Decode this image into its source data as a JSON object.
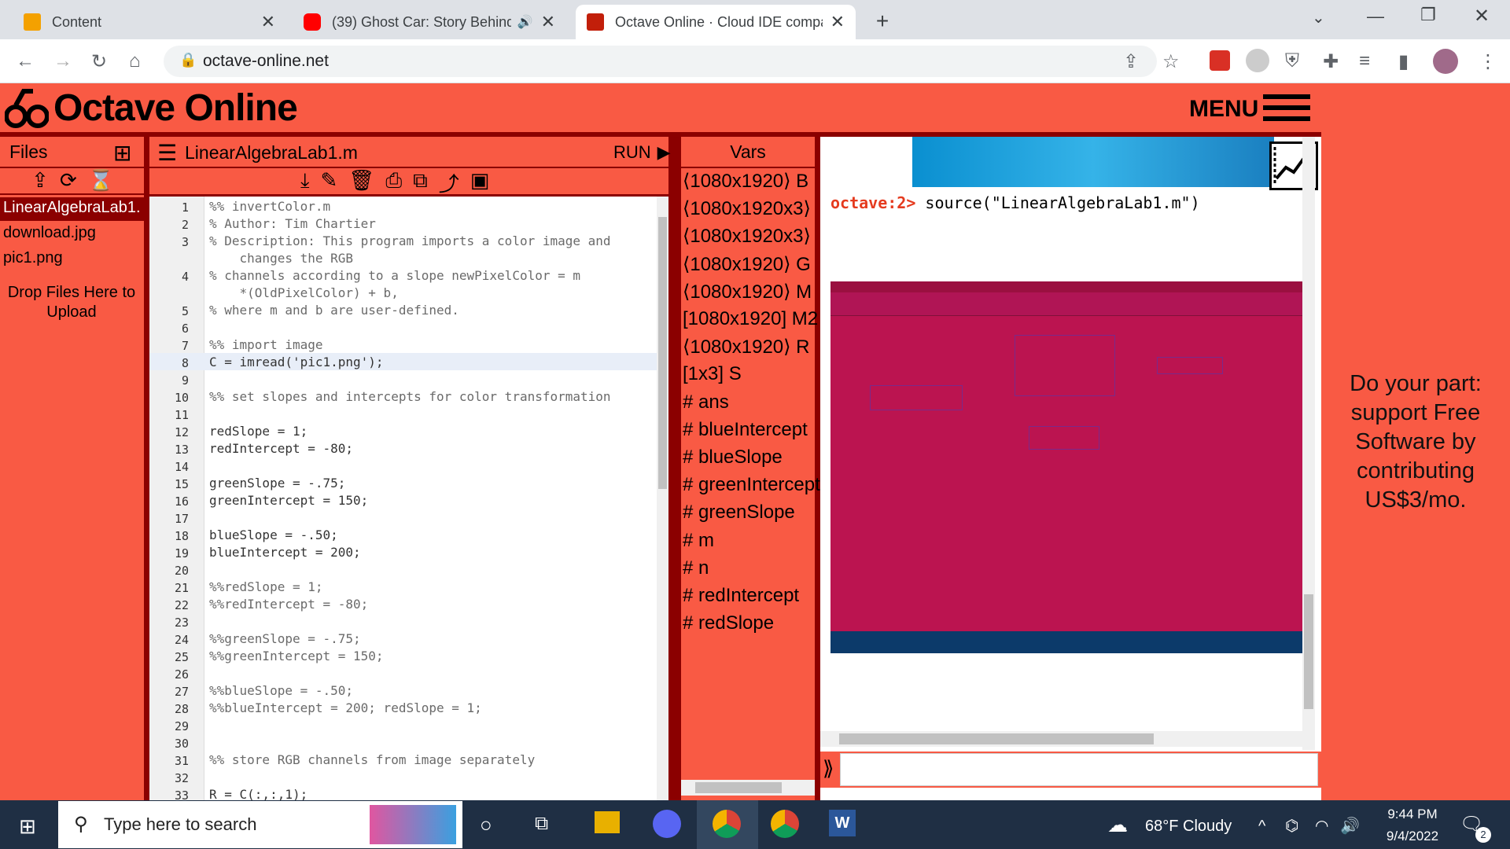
{
  "browser": {
    "tabs": [
      {
        "title": "Content",
        "favicon_color": "#f4a100",
        "active": false
      },
      {
        "title": "(39) Ghost Car: Story Behind",
        "favicon_color": "#ff0000",
        "active": false
      },
      {
        "title": "Octave Online · Cloud IDE compa",
        "favicon_color": "#c21f0a",
        "active": true
      }
    ],
    "new_tab_icon": "plus-icon",
    "url": "octave-online.net"
  },
  "octave": {
    "brand": "Octave Online",
    "menu_label": "MENU",
    "files": {
      "title": "Files",
      "items": [
        "LinearAlgebraLab1.",
        "download.jpg",
        "pic1.png"
      ],
      "drop_hint": "Drop Files Here to Upload"
    },
    "editor": {
      "filename": "LinearAlgebraLab1.m",
      "run_label": "RUN",
      "lines": [
        {
          "n": "1",
          "text": "%% invertColor.m",
          "comment": true
        },
        {
          "n": "2",
          "text": "% Author: Tim Chartier",
          "comment": true
        },
        {
          "n": "3",
          "text": "% Description: This program imports a color image and",
          "comment": true
        },
        {
          "n": "",
          "text": "    changes the RGB",
          "comment": true
        },
        {
          "n": "4",
          "text": "% channels according to a slope newPixelColor = m",
          "comment": true
        },
        {
          "n": "",
          "text": "    *(OldPixelColor) + b,",
          "comment": true
        },
        {
          "n": "5",
          "text": "% where m and b are user-defined.",
          "comment": true
        },
        {
          "n": "6",
          "text": "",
          "comment": false
        },
        {
          "n": "7",
          "text": "%% import image",
          "comment": true
        },
        {
          "n": "8",
          "text": "C = imread('pic1.png');",
          "comment": false
        },
        {
          "n": "9",
          "text": "",
          "comment": false
        },
        {
          "n": "10",
          "text": "%% set slopes and intercepts for color transformation",
          "comment": true
        },
        {
          "n": "11",
          "text": "",
          "comment": false
        },
        {
          "n": "12",
          "text": "redSlope = 1;",
          "comment": false
        },
        {
          "n": "13",
          "text": "redIntercept = -80;",
          "comment": false
        },
        {
          "n": "14",
          "text": "",
          "comment": false
        },
        {
          "n": "15",
          "text": "greenSlope = -.75;",
          "comment": false
        },
        {
          "n": "16",
          "text": "greenIntercept = 150;",
          "comment": false
        },
        {
          "n": "17",
          "text": "",
          "comment": false
        },
        {
          "n": "18",
          "text": "blueSlope = -.50;",
          "comment": false
        },
        {
          "n": "19",
          "text": "blueIntercept = 200;",
          "comment": false
        },
        {
          "n": "20",
          "text": "",
          "comment": false
        },
        {
          "n": "21",
          "text": "%%redSlope = 1;",
          "comment": true
        },
        {
          "n": "22",
          "text": "%%redIntercept = -80;",
          "comment": true
        },
        {
          "n": "23",
          "text": "",
          "comment": false
        },
        {
          "n": "24",
          "text": "%%greenSlope = -.75;",
          "comment": true
        },
        {
          "n": "25",
          "text": "%%greenIntercept = 150;",
          "comment": true
        },
        {
          "n": "26",
          "text": "",
          "comment": false
        },
        {
          "n": "27",
          "text": "%%blueSlope = -.50;",
          "comment": true
        },
        {
          "n": "28",
          "text": "%%blueIntercept = 200; redSlope = 1;",
          "comment": true
        },
        {
          "n": "29",
          "text": "",
          "comment": false
        },
        {
          "n": "30",
          "text": "",
          "comment": false
        },
        {
          "n": "31",
          "text": "%% store RGB channels from image separately",
          "comment": true
        },
        {
          "n": "32",
          "text": "",
          "comment": false
        },
        {
          "n": "33",
          "text": "R = C(:,:,1);",
          "comment": false
        }
      ]
    },
    "vars": {
      "title": "Vars",
      "items": [
        "⟨1080x1920⟩ B",
        "⟨1080x1920x3⟩",
        "⟨1080x1920x3⟩",
        "⟨1080x1920⟩ G",
        "⟨1080x1920⟩ M",
        "[1080x1920] M2",
        "⟨1080x1920⟩ R",
        "[1x3] S",
        "# ans",
        "# blueIntercept",
        "# blueSlope",
        "# greenIntercept",
        "# greenSlope",
        "# m",
        "# n",
        "# redIntercept",
        "# redSlope"
      ]
    },
    "console": {
      "prompt": "octave:2>",
      "command": "source(\"LinearAlgebraLab1.m\")"
    },
    "donate": "Do your part: support Free Software by contributing US$3/mo."
  },
  "taskbar": {
    "search_placeholder": "Type here to search",
    "weather": "68°F  Cloudy",
    "time": "9:44 PM",
    "date": "9/4/2022",
    "notifications": "2"
  }
}
